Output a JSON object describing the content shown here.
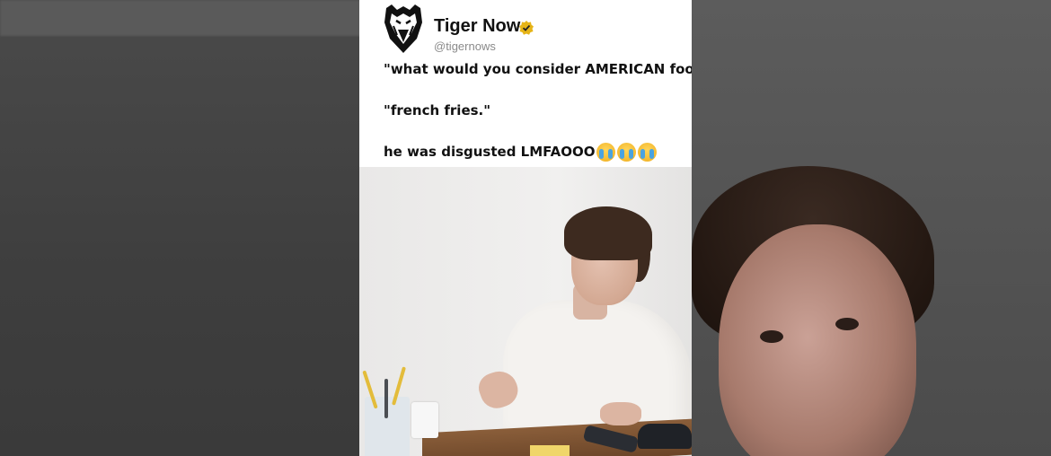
{
  "post": {
    "author_name": "Tiger Now",
    "author_handle": "@tigernows",
    "verified": true,
    "lines": [
      "\"what would you consider AMERICAN food?\"",
      "\"french fries.\"",
      "he was disgusted LMFAOOO"
    ],
    "trailing_emoji": [
      "loudly-crying-face",
      "loudly-crying-face",
      "loudly-crying-face"
    ]
  },
  "colors": {
    "card_bg": "#ffffff",
    "verified_badge": "#e6b417",
    "backdrop": "#3a3a3a"
  },
  "icons": {
    "avatar": "tiger-logo-icon",
    "verified": "verified-badge-icon"
  }
}
